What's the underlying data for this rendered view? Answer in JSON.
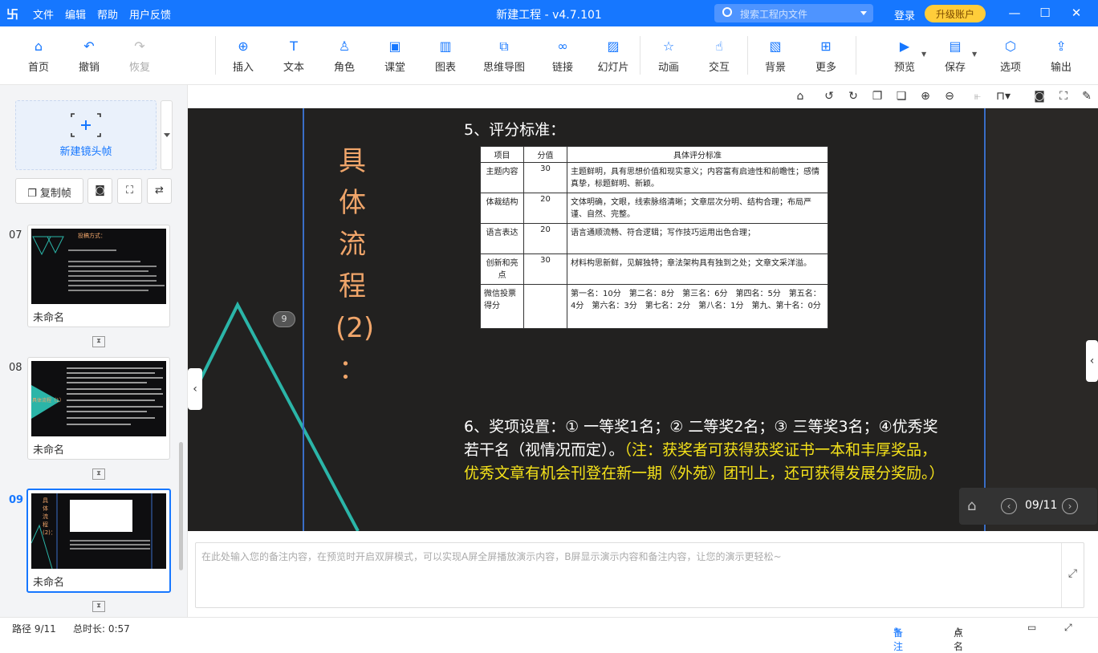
{
  "titlebar": {
    "logo": "卐",
    "menus": [
      "文件",
      "编辑",
      "帮助",
      "用户反馈"
    ],
    "title": "新建工程 - v4.7.101",
    "search_placeholder": "搜索工程内文件",
    "login": "登录",
    "upgrade": "升级账户"
  },
  "toolbar": {
    "home": "首页",
    "undo": "撤销",
    "redo": "恢复",
    "insert": "插入",
    "text": "文本",
    "role": "角色",
    "classroom": "课堂",
    "chart": "图表",
    "mindmap": "思维导图",
    "link": "链接",
    "slideshow": "幻灯片",
    "animation": "动画",
    "interaction": "交互",
    "background": "背景",
    "more": "更多",
    "preview": "预览",
    "save": "保存",
    "options": "选项",
    "export": "输出"
  },
  "sidebar": {
    "new_frame": "新建镜头帧",
    "copy_frame": "复制帧",
    "slides": [
      {
        "num": "07",
        "name": "未命名",
        "thumb_title": "投稿方式："
      },
      {
        "num": "08",
        "name": "未命名",
        "thumb_title": "具体流程（1）"
      },
      {
        "num": "09",
        "name": "未命名",
        "thumb_title": "具体流程(2)："
      }
    ]
  },
  "slide": {
    "vertical_title": [
      "具",
      "体",
      "流",
      "程",
      "(2)",
      "："
    ],
    "badge": "9",
    "section5": "5、评分标准：",
    "table": {
      "headers": [
        "项目",
        "分值",
        "具体评分标准"
      ],
      "rows": [
        [
          "主题内容",
          "30",
          "主题鲜明，具有思想价值和现实意义；内容富有启迪性和前瞻性；感情真挚，标题鲜明、新颖。"
        ],
        [
          "体裁结构",
          "20",
          "文体明确，文眼，线索脉络清晰；文章层次分明、结构合理；布局严谨、自然、完整。"
        ],
        [
          "语言表达",
          "20",
          "语言通顺流畅、符合逻辑；写作技巧运用出色合理；"
        ],
        [
          "创新和亮点",
          "30",
          "材料构思新鲜，见解独特；章法架构具有独到之处；文章文采洋溢。"
        ],
        [
          "微信投票得分",
          "",
          "第一名：10分　第二名：8分　第三名：6分　第四名：5分　第五名：4分　第六名：3分　第七名：2分　第八名：1分　第九、第十名：0分"
        ]
      ]
    },
    "section6": "6、奖项设置：① 一等奖1名；② 二等奖2名；③ 三等奖3名；④优秀奖若干名（视情况而定）。",
    "note": "（注：获奖者可获得获奖证书一本和丰厚奖品，优秀文章有机会刊登在新一期《外苑》团刊上，还可获得发展分奖励。）"
  },
  "pager": {
    "page": "09/11"
  },
  "notes": {
    "placeholder": "在此处输入您的备注内容，在预览时开启双屏模式，可以实现A屏全屏播放演示内容，B屏显示演示内容和备注内容，让您的演示更轻松~"
  },
  "status": {
    "path": "路径 9/11",
    "duration": "总时长: 0:57",
    "notes_btn": "备注",
    "rollcall": "点名"
  },
  "colors": {
    "brand": "#1677ff",
    "stage_bg": "#222120",
    "title_orange": "#f0a56a",
    "note_yellow": "#f5e21a",
    "teal": "#2bb5a8"
  }
}
